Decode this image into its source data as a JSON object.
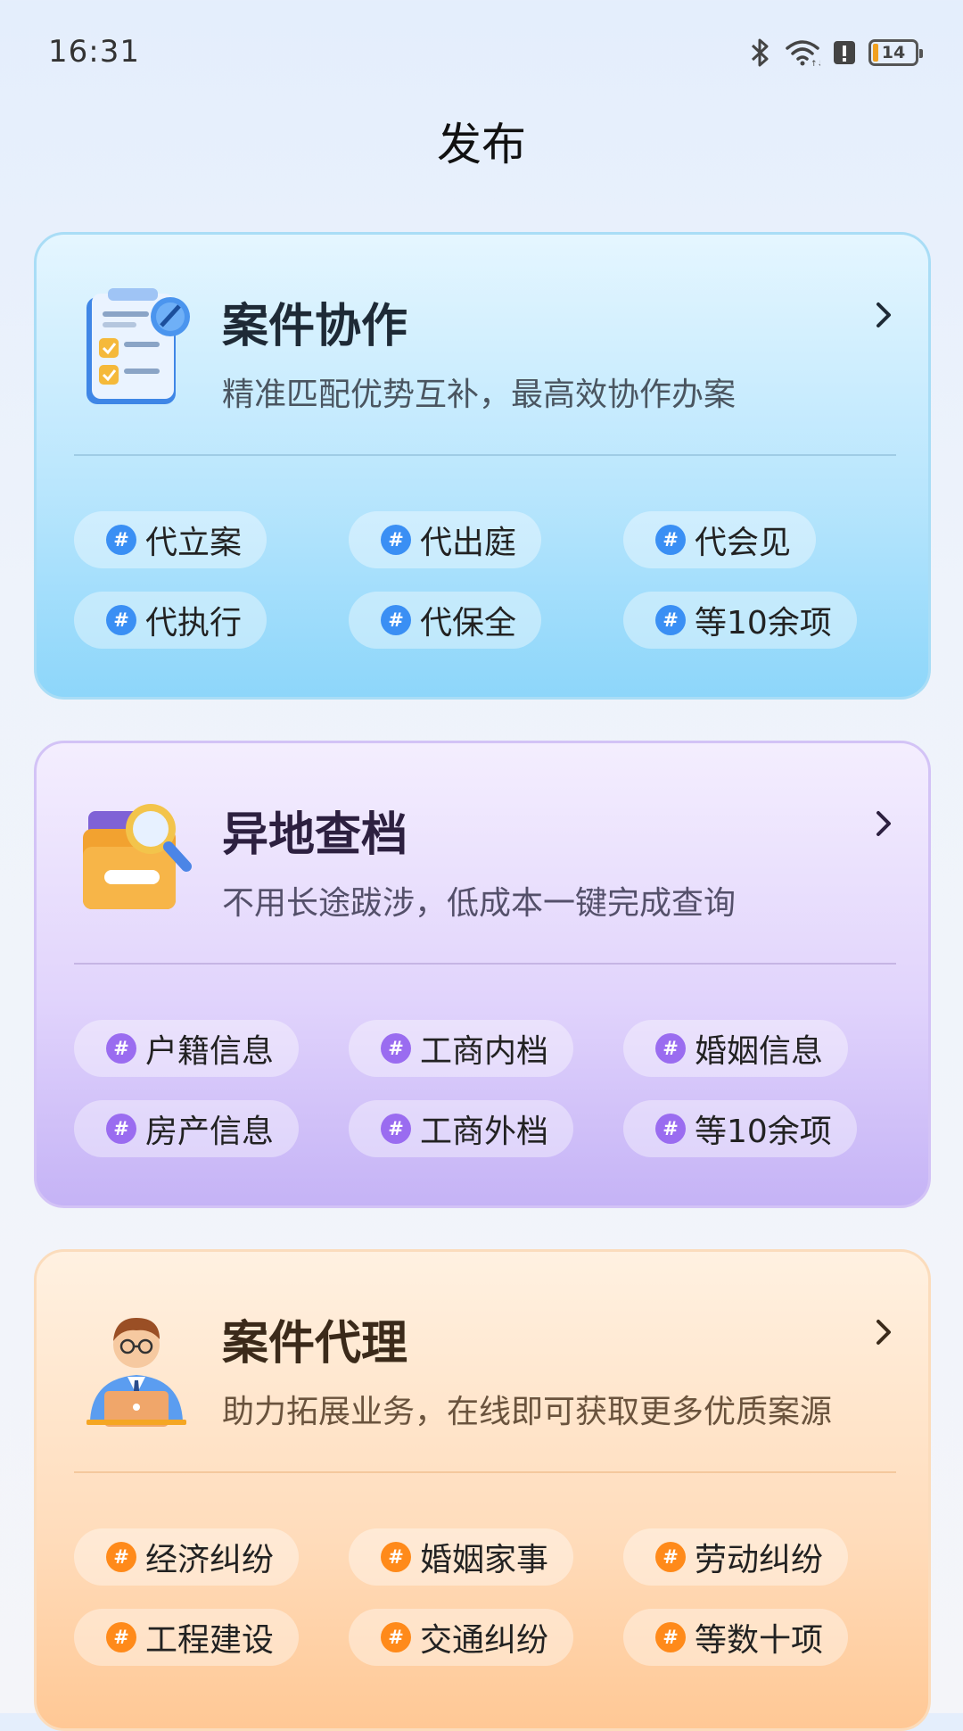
{
  "status_bar": {
    "time": "16:31",
    "battery_level": "14"
  },
  "page": {
    "title": "发布"
  },
  "cards": [
    {
      "title": "案件协作",
      "subtitle": "精准匹配优势互补，最高效协作办案",
      "icon": "clipboard-checklist-icon",
      "accent": "#3a8ff4",
      "tags": [
        "代立案",
        "代出庭",
        "代会见",
        "代执行",
        "代保全",
        "等10余项"
      ]
    },
    {
      "title": "异地查档",
      "subtitle": "不用长途跋涉，低成本一键完成查询",
      "icon": "folder-search-icon",
      "accent": "#9a6cf0",
      "tags": [
        "户籍信息",
        "工商内档",
        "婚姻信息",
        "房产信息",
        "工商外档",
        "等10余项"
      ]
    },
    {
      "title": "案件代理",
      "subtitle": "助力拓展业务，在线即可获取更多优质案源",
      "icon": "lawyer-laptop-icon",
      "accent": "#ff8a1a",
      "tags": [
        "经济纠纷",
        "婚姻家事",
        "劳动纠纷",
        "工程建设",
        "交通纠纷",
        "等数十项"
      ]
    }
  ]
}
